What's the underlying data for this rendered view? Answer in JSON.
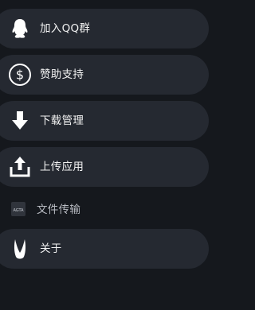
{
  "menu": {
    "items": [
      {
        "label": "加入QQ群",
        "icon": "qq-penguin-icon"
      },
      {
        "label": "赞助支持",
        "icon": "dollar-circle-icon"
      },
      {
        "label": "下载管理",
        "icon": "download-arrow-icon"
      },
      {
        "label": "上传应用",
        "icon": "upload-tray-icon"
      },
      {
        "label": "文件传输",
        "icon": "app-logo-icon",
        "icon_text": "AGTA"
      },
      {
        "label": "关于",
        "icon": "horn-logo-icon"
      }
    ]
  },
  "colors": {
    "background": "#15181d",
    "item_background": "#252931",
    "text": "#f2f2f2",
    "muted_text": "#b9bcc3"
  }
}
